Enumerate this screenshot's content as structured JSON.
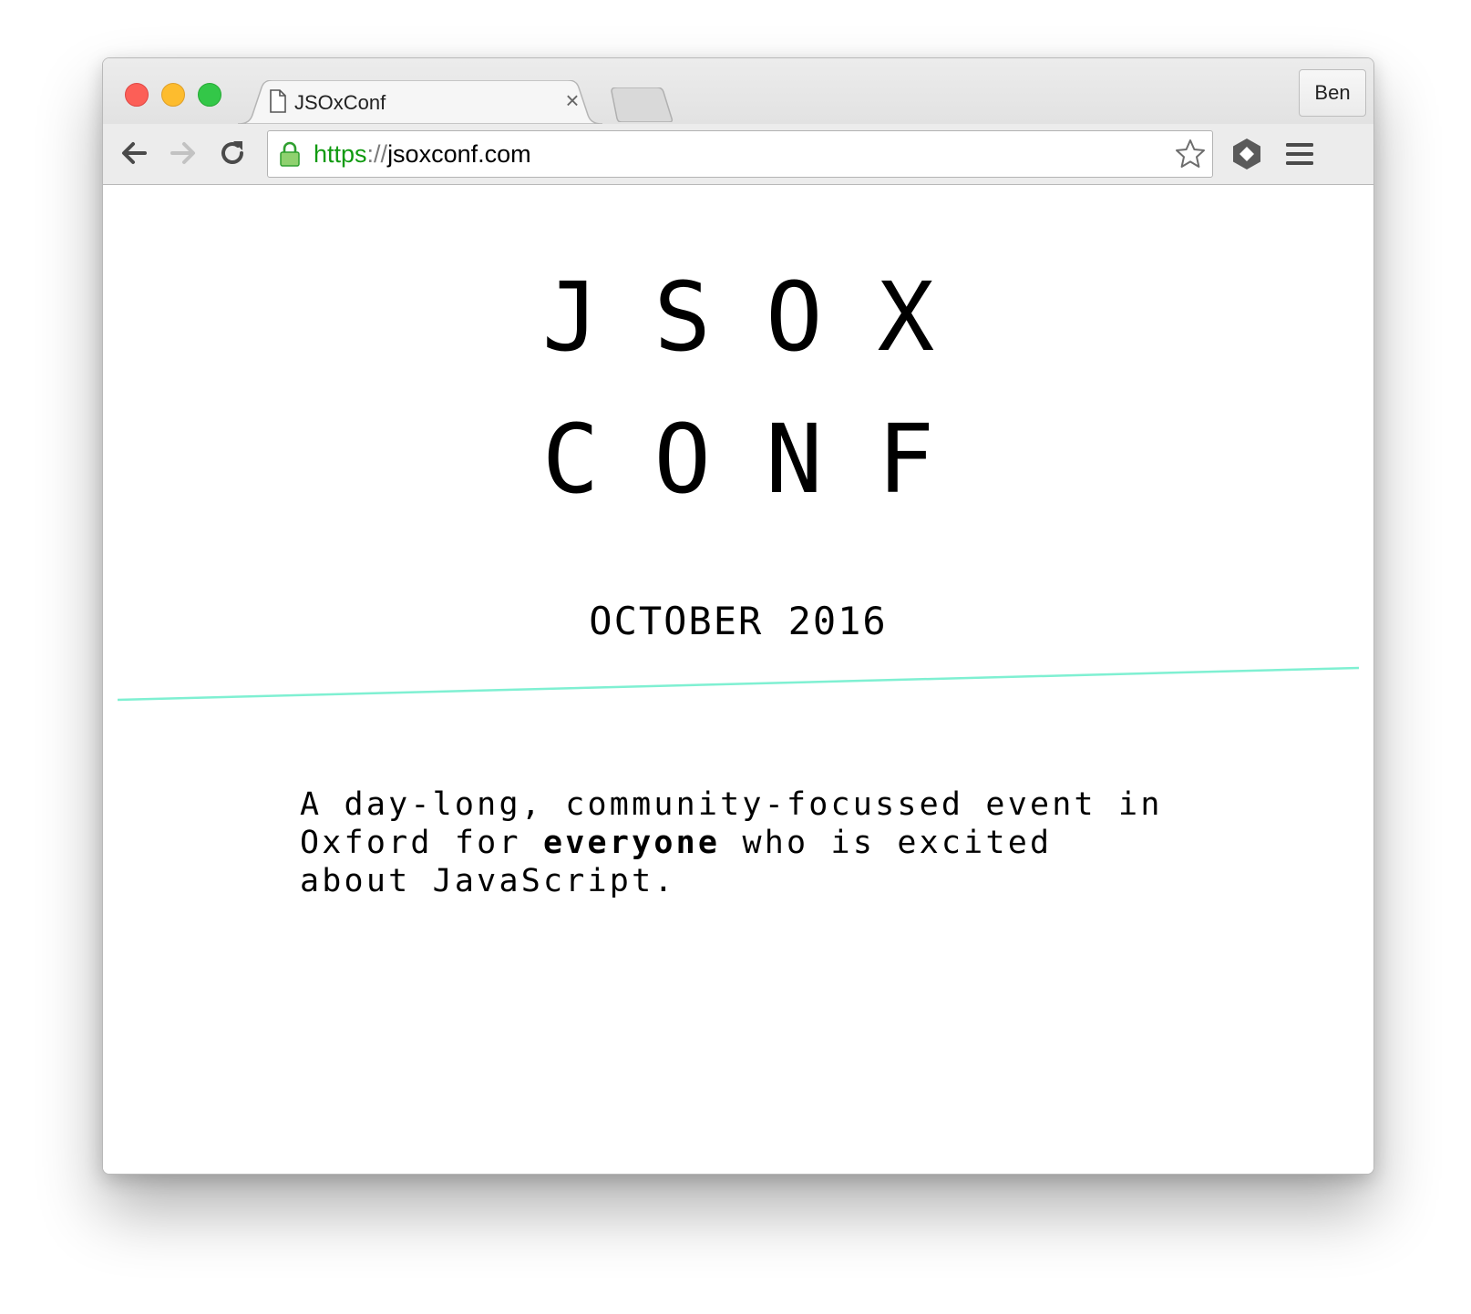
{
  "browser": {
    "tab": {
      "title": "JSOxConf",
      "close": "×"
    },
    "profile": "Ben",
    "address": {
      "scheme": "https",
      "separator": "://",
      "host": "jsoxconf.com"
    },
    "icons": {
      "back": "arrow-left-icon",
      "forward": "arrow-right-icon",
      "reload": "reload-icon",
      "lock": "lock-icon",
      "star": "star-icon",
      "extension": "extension-icon",
      "menu": "hamburger-menu-icon",
      "tab_page": "document-icon"
    }
  },
  "page": {
    "logo_line1": "JSOX",
    "logo_line2": "CONF",
    "date": "OCTOBER 2016",
    "description": {
      "before": "A day-long, community-focussed event in Oxford for ",
      "emphasis": "everyone",
      "after": " who is excited about JavaScript."
    },
    "accent_color": "#7ff0d2"
  }
}
